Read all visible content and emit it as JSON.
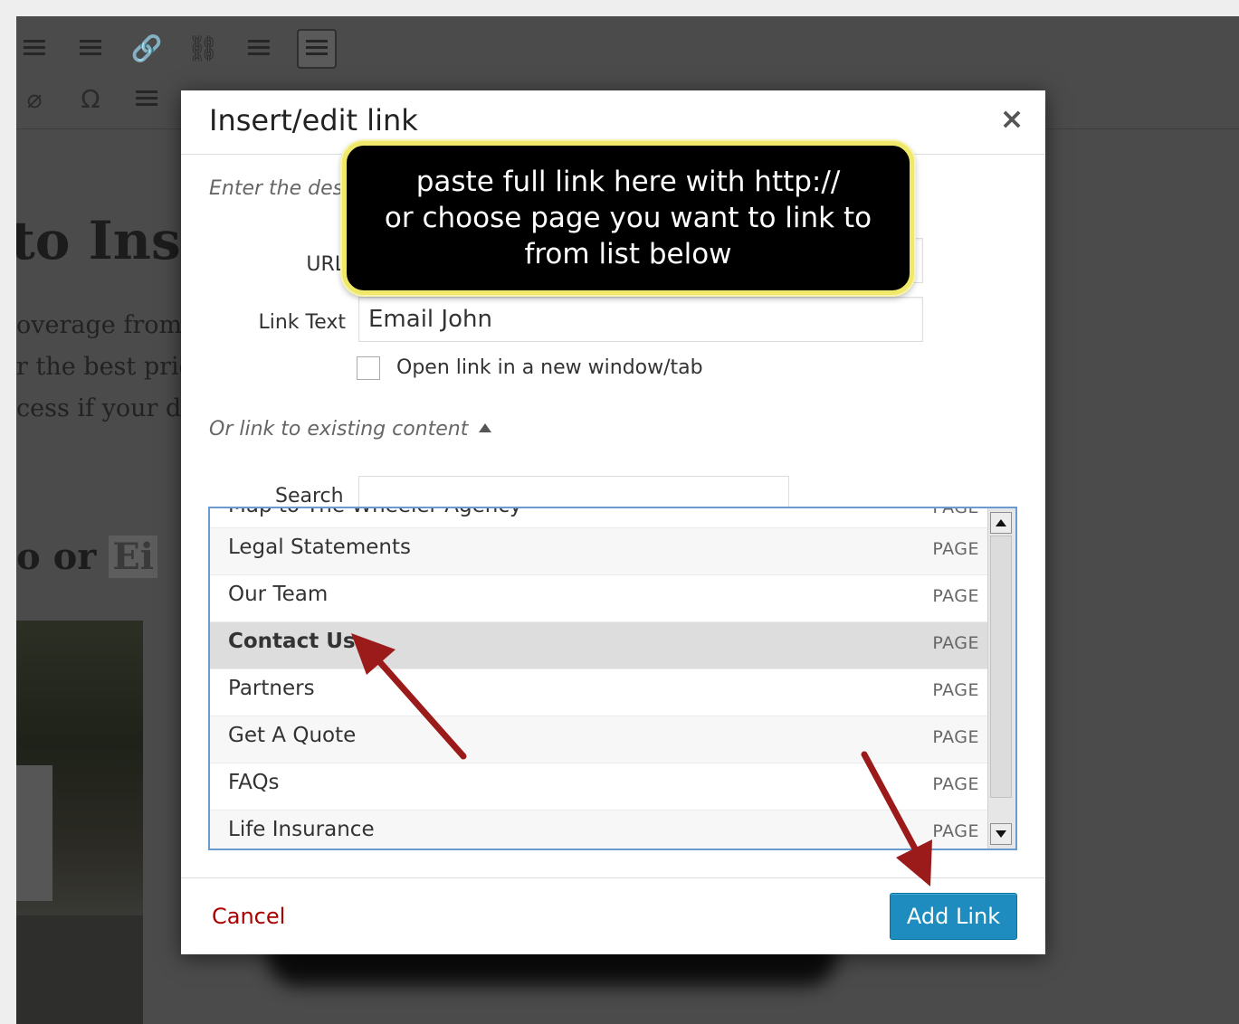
{
  "background": {
    "heading1": "to Insu",
    "paragraph_lines": [
      "overage from",
      "r the best pric",
      "cess if your dr"
    ],
    "heading2_text": "o or",
    "heading2_highlight": "Ei"
  },
  "dialog": {
    "title": "Insert/edit link",
    "close_symbol": "×",
    "hint": "Enter the dest",
    "url_label": "URL",
    "url_value": "",
    "link_text_label": "Link Text",
    "link_text_value": "Email John",
    "new_tab_label": "Open link in a new window/tab",
    "new_tab_checked": false,
    "existing_toggle": "Or link to existing content",
    "search_label": "Search",
    "search_value": "",
    "results": [
      {
        "title": "Map to The Wheeler Agency",
        "type": "PAGE",
        "partial": true
      },
      {
        "title": "Legal Statements",
        "type": "PAGE"
      },
      {
        "title": "Our Team",
        "type": "PAGE"
      },
      {
        "title": "Contact Us",
        "type": "PAGE",
        "selected": true
      },
      {
        "title": "Partners",
        "type": "PAGE"
      },
      {
        "title": "Get A Quote",
        "type": "PAGE"
      },
      {
        "title": "FAQs",
        "type": "PAGE"
      },
      {
        "title": "Life Insurance",
        "type": "PAGE"
      }
    ],
    "cancel_label": "Cancel",
    "add_link_label": "Add Link"
  },
  "callout": {
    "lines": [
      "paste full link here with http://",
      "or choose page you want to link to",
      "from list below"
    ]
  },
  "colors": {
    "add_link_blue": "#1e8cbe",
    "cancel_red": "#aa0000",
    "arrow_red": "#9b1b1b",
    "callout_border": "#efe86a"
  }
}
